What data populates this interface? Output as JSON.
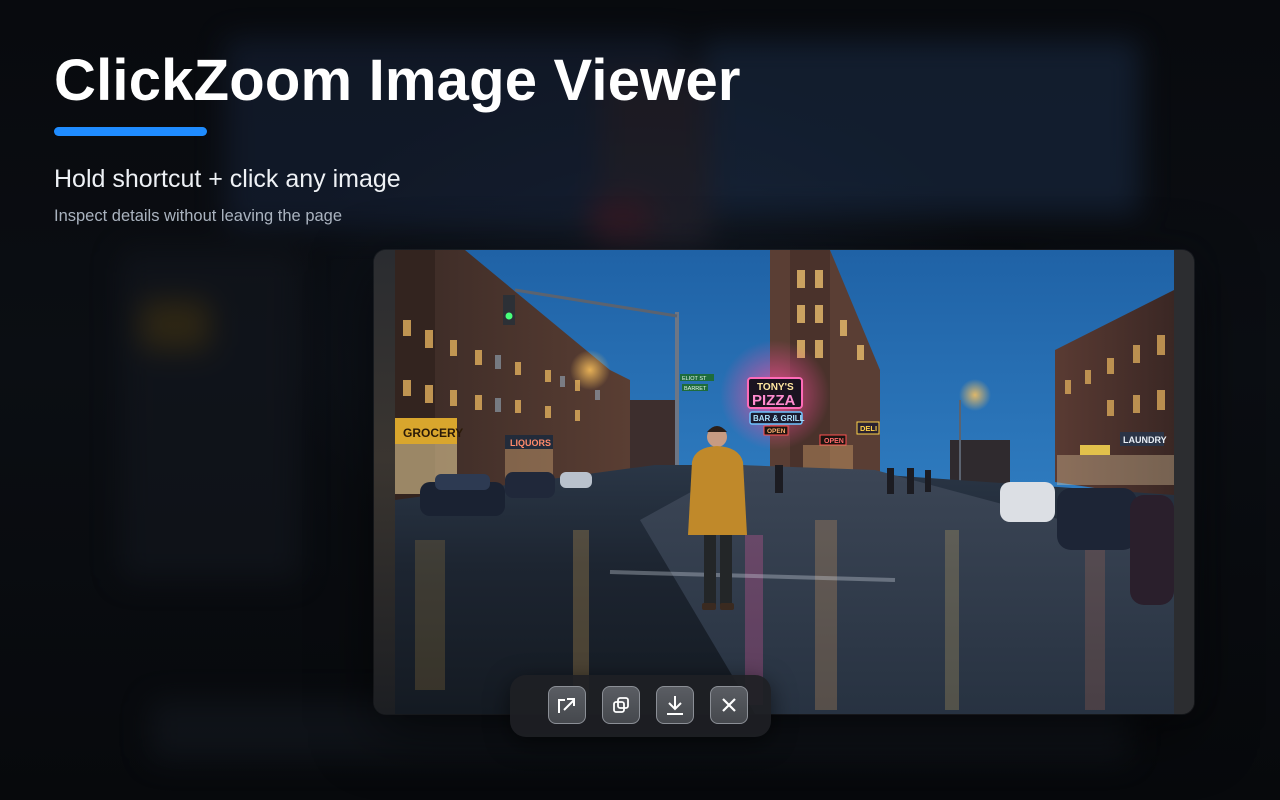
{
  "hero": {
    "title": "ClickZoom Image Viewer",
    "subtitle": "Hold shortcut + click any image",
    "caption": "Inspect details without leaving the page",
    "accent_color": "#1f8cff"
  },
  "viewer": {
    "signs": {
      "pizza_top": "TONY'S",
      "pizza_bottom": "PIZZA",
      "bar_grill": "BAR & GRILL",
      "open_1": "OPEN",
      "open_2": "OPEN",
      "deli": "DELI",
      "grocery": "GROCERY",
      "liquors": "LIQUORS",
      "laundry": "LAUNDRY",
      "street_1": "ELIOT ST",
      "street_2": "BARRET"
    },
    "toolbar": [
      {
        "action": "open-in-new-tab",
        "icon": "external-link-icon"
      },
      {
        "action": "copy-image",
        "icon": "copy-icon"
      },
      {
        "action": "download-image",
        "icon": "download-icon"
      },
      {
        "action": "close-viewer",
        "icon": "close-icon"
      }
    ]
  }
}
